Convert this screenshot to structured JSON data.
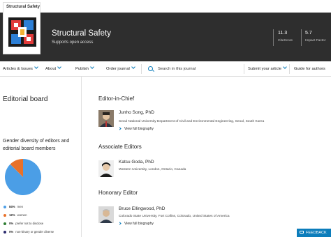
{
  "header": {
    "cover_title": "Structural Safety",
    "journal_title": "Structural Safety",
    "journal_subtitle": "Supports open access",
    "metrics": [
      {
        "value": "11.3",
        "label": "CiteScore"
      },
      {
        "value": "5.7",
        "label": "Impact Factor"
      }
    ]
  },
  "nav": {
    "articles": "Articles & Issues",
    "about": "About",
    "publish": "Publish",
    "order": "Order journal",
    "search_placeholder": "Search in this journal",
    "submit": "Submit your article",
    "guide": "Guide for authors"
  },
  "left": {
    "title": "Editorial board",
    "diversity_title": "Gender diversity of editors and editorial board members",
    "legend": [
      {
        "value": "84%",
        "label": "men",
        "color": "#4b9ee6"
      },
      {
        "value": "12%",
        "label": "women",
        "color": "#e8712a"
      },
      {
        "value": "0%",
        "label": "prefer not to disclose",
        "color": "#2e7d32"
      },
      {
        "value": "0%",
        "label": "non-binary or gender diverse",
        "color": "#2b2b6e"
      }
    ]
  },
  "sections": {
    "eic": "Editor-in-Chief",
    "assoc": "Associate Editors",
    "honorary": "Honorary Editor"
  },
  "people": {
    "song": {
      "name": "Junho Song, PhD",
      "affiliation": "Seoul National University Department of Civil and Environmental Engineering, Seoul, South Korea",
      "bio": "View full biography"
    },
    "goda": {
      "name": "Katsu Goda, PhD",
      "affiliation": "Western University, London, Ontario, Canada"
    },
    "ellingwood": {
      "name": "Bruce Ellingwood, PhD",
      "affiliation": "Colorado State University, Fort Collins, Colorado, United States of America",
      "bio": "View full biography"
    }
  },
  "feedback": "FEEDBACK",
  "colors": {
    "accent": "#0c7dbb",
    "header_bg": "#2e2e2e"
  }
}
